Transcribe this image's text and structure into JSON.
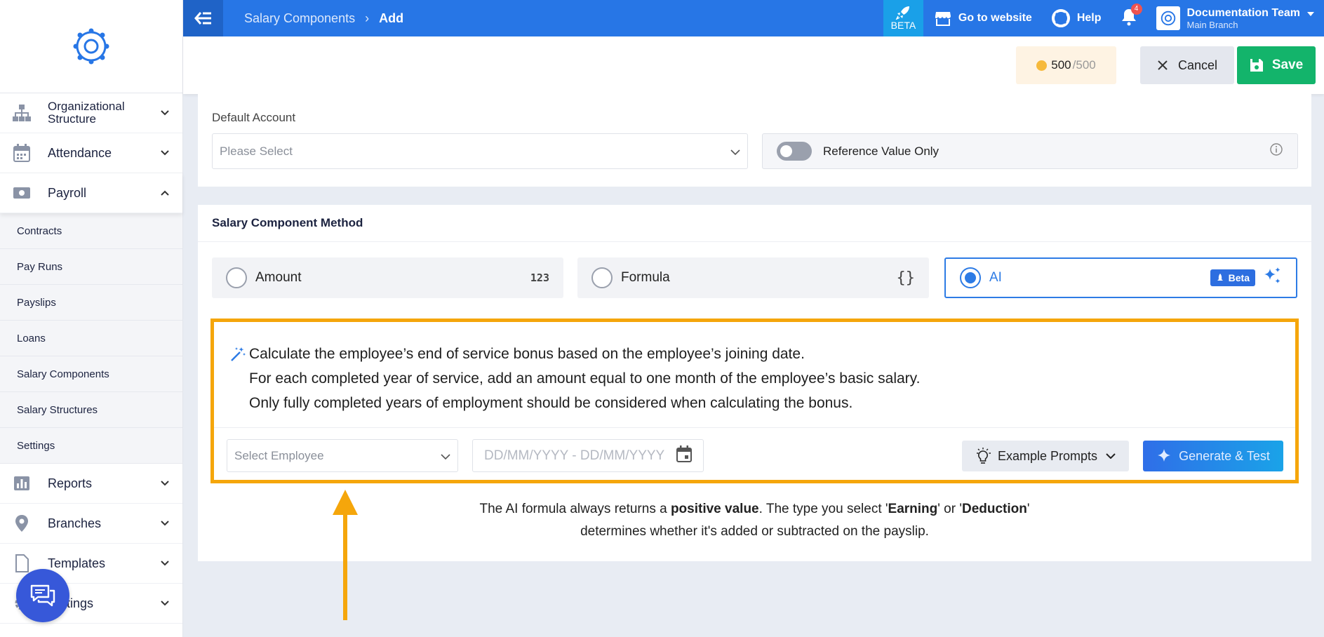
{
  "topbar": {
    "breadcrumb": [
      "Salary Components",
      "Add"
    ],
    "beta_label": "BETA",
    "go_to_website": "Go to website",
    "help": "Help",
    "notification_count": "4",
    "user_name": "Documentation Team",
    "user_branch": "Main Branch"
  },
  "sidebar": {
    "items": [
      {
        "label": "Organizational Structure",
        "icon": "org-structure-icon"
      },
      {
        "label": "Attendance",
        "icon": "calendar-icon"
      },
      {
        "label": "Payroll",
        "icon": "money-icon"
      }
    ],
    "payroll_sub": [
      "Contracts",
      "Pay Runs",
      "Payslips",
      "Loans",
      "Salary Components",
      "Salary Structures",
      "Settings"
    ],
    "bottom_items": [
      {
        "label": "Reports",
        "icon": "bar-chart-icon"
      },
      {
        "label": "Branches",
        "icon": "location-pin-icon"
      },
      {
        "label": "Templates",
        "icon": "document-icon"
      },
      {
        "label": "Settings",
        "icon": "gear-icon"
      }
    ]
  },
  "actions": {
    "credits_used": "500",
    "credits_total": "/500",
    "cancel": "Cancel",
    "save": "Save"
  },
  "default_account": {
    "label": "Default Account",
    "placeholder": "Please Select",
    "reference_value_only": "Reference Value Only"
  },
  "method": {
    "title": "Salary Component Method",
    "options": [
      {
        "label": "Amount",
        "icon": "123"
      },
      {
        "label": "Formula",
        "icon": "{}"
      },
      {
        "label": "AI",
        "badge": "Beta"
      }
    ],
    "selected": "AI"
  },
  "ai": {
    "prompt_lines": [
      "Calculate the employee’s end of service bonus based on the employee’s joining date.",
      "For each completed year of service, add an amount equal to one month of the employee’s basic salary.",
      "Only fully completed years of employment should be considered when calculating the bonus."
    ],
    "employee_placeholder": "Select Employee",
    "date_placeholder": "DD/MM/YYYY - DD/MM/YYYY",
    "example_prompts": "Example Prompts",
    "generate_test": "Generate & Test",
    "note_parts": [
      "The AI formula always returns a ",
      "positive value",
      ". The type you select '",
      "Earning",
      "' or '",
      "Deduction",
      "'",
      "determines whether it's added or subtracted on the payslip."
    ]
  },
  "colors": {
    "primary": "#2776e6",
    "save": "#13b46b",
    "highlight": "#f5a60b",
    "chat": "#3758d9"
  }
}
